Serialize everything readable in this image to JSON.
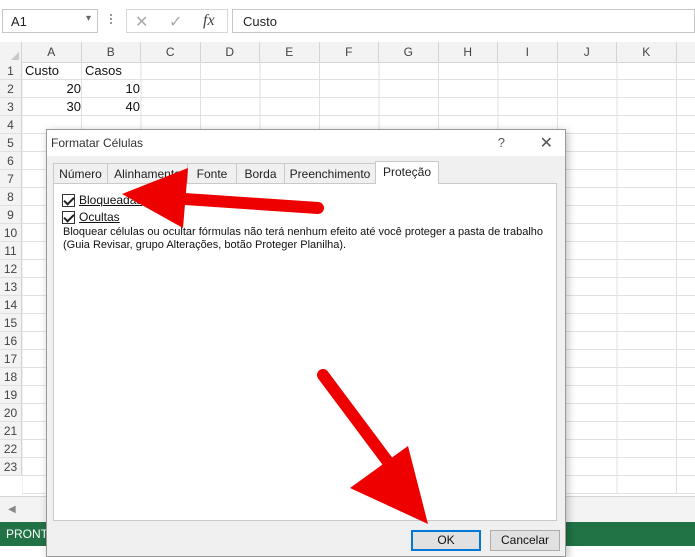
{
  "formula_bar": {
    "name_box": "A1",
    "cancel_icon": "✕",
    "enter_icon": "✓",
    "fx": "fx",
    "formula": "Custo"
  },
  "columns": [
    "A",
    "B",
    "C",
    "D",
    "E",
    "F",
    "G",
    "H",
    "I",
    "J",
    "K"
  ],
  "rows": [
    "1",
    "2",
    "3",
    "4",
    "5",
    "6",
    "7",
    "8",
    "9",
    "10",
    "11",
    "12",
    "13",
    "14",
    "15",
    "16",
    "17",
    "18",
    "19",
    "20",
    "21",
    "22",
    "23"
  ],
  "cells": {
    "A1": "Custo",
    "B1": "Casos",
    "A2": "20",
    "B2": "10",
    "A3": "30",
    "B3": "40"
  },
  "status": "PRONTO",
  "dialog": {
    "title": "Formatar Células",
    "help": "?",
    "close": "✕",
    "tabs": [
      "Número",
      "Alinhamento",
      "Fonte",
      "Borda",
      "Preenchimento",
      "Proteção"
    ],
    "active_tab": "Proteção",
    "locked_label": "Bloqueadas",
    "locked_checked": true,
    "hidden_label": "Ocultas",
    "hidden_checked": true,
    "note_line1": "Bloquear células ou ocultar fórmulas não terá nenhum efeito até você proteger a pasta de trabalho",
    "note_line2": "(Guia Revisar, grupo Alterações, botão Proteger Planilha).",
    "ok_label": "OK",
    "cancel_label": "Cancelar"
  },
  "colors": {
    "status_bar": "#217346",
    "annotation_arrow": "#ee0000",
    "ok_border": "#0078d7"
  }
}
